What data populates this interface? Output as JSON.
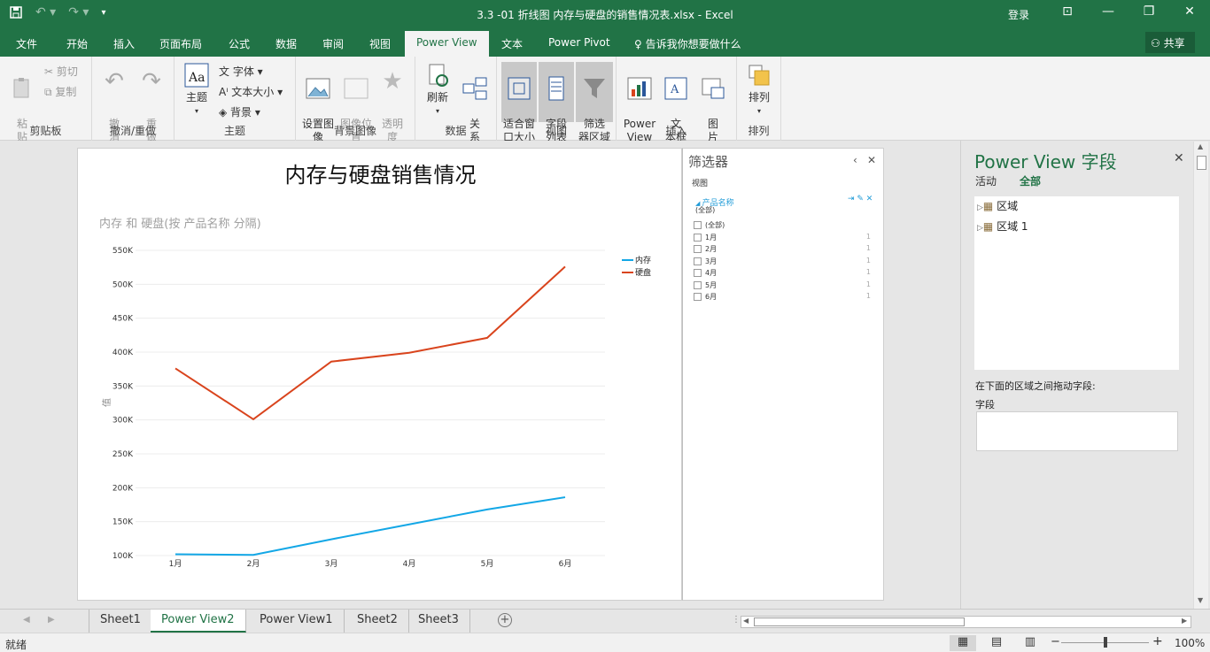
{
  "titlebar": {
    "title": "3.3 -01 折线图 内存与硬盘的销售情况表.xlsx  -  Excel",
    "login": "登录",
    "icons": [
      "save-icon",
      "undo-icon",
      "redo-icon",
      "customize-icon"
    ]
  },
  "tabs": [
    {
      "label": "文件"
    },
    {
      "label": "开始"
    },
    {
      "label": "插入"
    },
    {
      "label": "页面布局"
    },
    {
      "label": "公式"
    },
    {
      "label": "数据"
    },
    {
      "label": "审阅"
    },
    {
      "label": "视图"
    },
    {
      "label": "Power View"
    },
    {
      "label": "文本"
    },
    {
      "label": "Power Pivot"
    },
    {
      "label": "告诉我你想要做什么"
    }
  ],
  "share": "共享",
  "ribbon": {
    "clipboard": {
      "paste": "粘\n贴",
      "cut": "剪切",
      "copy": "复制",
      "label": "剪贴板"
    },
    "undo": {
      "undo": "撤\n消",
      "redo": "重\n做",
      "label": "撤消/重做"
    },
    "theme": {
      "theme": "主题",
      "font": "字体",
      "textsize": "文本大小",
      "background": "背景",
      "label": "主题"
    },
    "bgimage": {
      "set": "设置图\n像",
      "pos": "图像位\n置",
      "trans": "透明\n度",
      "label": "背景图像"
    },
    "data": {
      "refresh": "刷新",
      "rel": "关\n系",
      "label": "数据"
    },
    "view": {
      "fit": "适合窗\n口大小",
      "fields": "字段\n列表",
      "filter": "筛选\n器区域",
      "label": "视图"
    },
    "insert": {
      "pv": "Power\nView",
      "textbox": "文\n本框",
      "picture": "图\n片",
      "label": "插入"
    },
    "arrange": {
      "arrange": "排列",
      "label": "排列"
    }
  },
  "report": {
    "title": "内存与硬盘销售情况",
    "subtitle": "内存 和 硬盘(按 产品名称 分隔)",
    "yaxis_label": "值"
  },
  "chart_data": {
    "type": "line",
    "categories": [
      "1月",
      "2月",
      "3月",
      "4月",
      "5月",
      "6月"
    ],
    "series": [
      {
        "name": "内存",
        "color": "#13a7e6",
        "values": [
          102000,
          101000,
          124000,
          146000,
          168000,
          186000
        ]
      },
      {
        "name": "硬盘",
        "color": "#d9441d",
        "values": [
          376000,
          301000,
          386000,
          399000,
          421000,
          526000
        ]
      }
    ],
    "ylim": [
      100000,
      550000
    ],
    "yticks": [
      "100K",
      "150K",
      "200K",
      "250K",
      "300K",
      "350K",
      "400K",
      "450K",
      "500K",
      "550K"
    ],
    "grid": true,
    "legend": "top-right"
  },
  "filter": {
    "title": "筛选器",
    "view": "视图",
    "field": "产品名称",
    "all_label": "(全部)",
    "items": [
      {
        "label": "(全部)",
        "count": ""
      },
      {
        "label": "1月",
        "count": "1"
      },
      {
        "label": "2月",
        "count": "1"
      },
      {
        "label": "3月",
        "count": "1"
      },
      {
        "label": "4月",
        "count": "1"
      },
      {
        "label": "5月",
        "count": "1"
      },
      {
        "label": "6月",
        "count": "1"
      }
    ]
  },
  "fields_pane": {
    "title": "Power View 字段",
    "tab_active": "活动",
    "tab_all": "全部",
    "tree": [
      "区域",
      "区域 1"
    ],
    "hint": "在下面的区域之间拖动字段:",
    "field_label": "字段"
  },
  "sheets": [
    "Sheet1",
    "Power View2",
    "Power View1",
    "Sheet2",
    "Sheet3"
  ],
  "active_sheet": "Power View2",
  "status": {
    "ready": "就绪",
    "zoom": "100%"
  }
}
